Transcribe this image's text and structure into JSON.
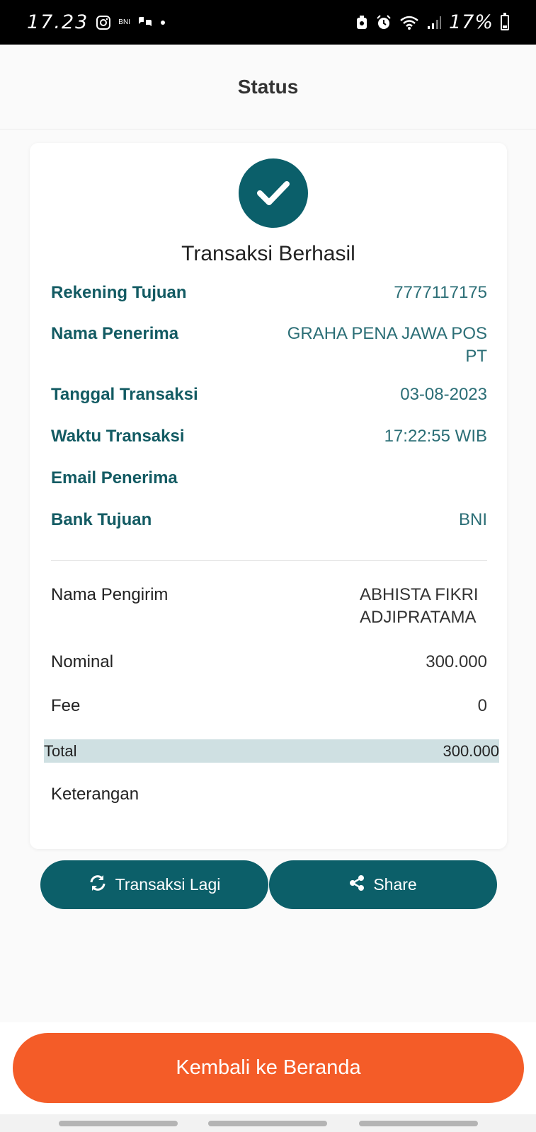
{
  "status_bar": {
    "time": "17.23",
    "bni_label": "BNI",
    "battery": "17%",
    "icons": [
      "instagram-icon",
      "bni-icon",
      "chat-icon",
      "dot-icon",
      "recycle-icon",
      "alarm-icon",
      "wifi-icon",
      "signal-icon",
      "battery-icon"
    ]
  },
  "header": {
    "title": "Status"
  },
  "receipt": {
    "title": "Transaksi Berhasil",
    "rows": [
      {
        "label": "Rekening Tujuan",
        "value": "7777117175"
      },
      {
        "label": "Nama Penerima",
        "value": "GRAHA PENA JAWA POS PT"
      },
      {
        "label": "Tanggal Transaksi",
        "value": "03-08-2023"
      },
      {
        "label": "Waktu Transaksi",
        "value": "17:22:55 WIB"
      },
      {
        "label": "Email Penerima",
        "value": ""
      },
      {
        "label": "Bank Tujuan",
        "value": "BNI"
      }
    ],
    "sender": {
      "label": "Nama Pengirim",
      "value": "ABHISTA FIKRI ADJIPRATAMA"
    },
    "nominal": {
      "label": "Nominal",
      "value": "300.000"
    },
    "fee": {
      "label": "Fee",
      "value": "0"
    },
    "total": {
      "label": "Total",
      "value": "300.000"
    },
    "note": {
      "label": "Keterangan",
      "value": ""
    }
  },
  "actions": {
    "again_label": "Transaksi Lagi",
    "share_label": "Share"
  },
  "footer": {
    "home_label": "Kembali ke Beranda"
  },
  "colors": {
    "primary": "#0c5f69",
    "accent": "#f45c28",
    "total_highlight": "#cfe0e2"
  }
}
